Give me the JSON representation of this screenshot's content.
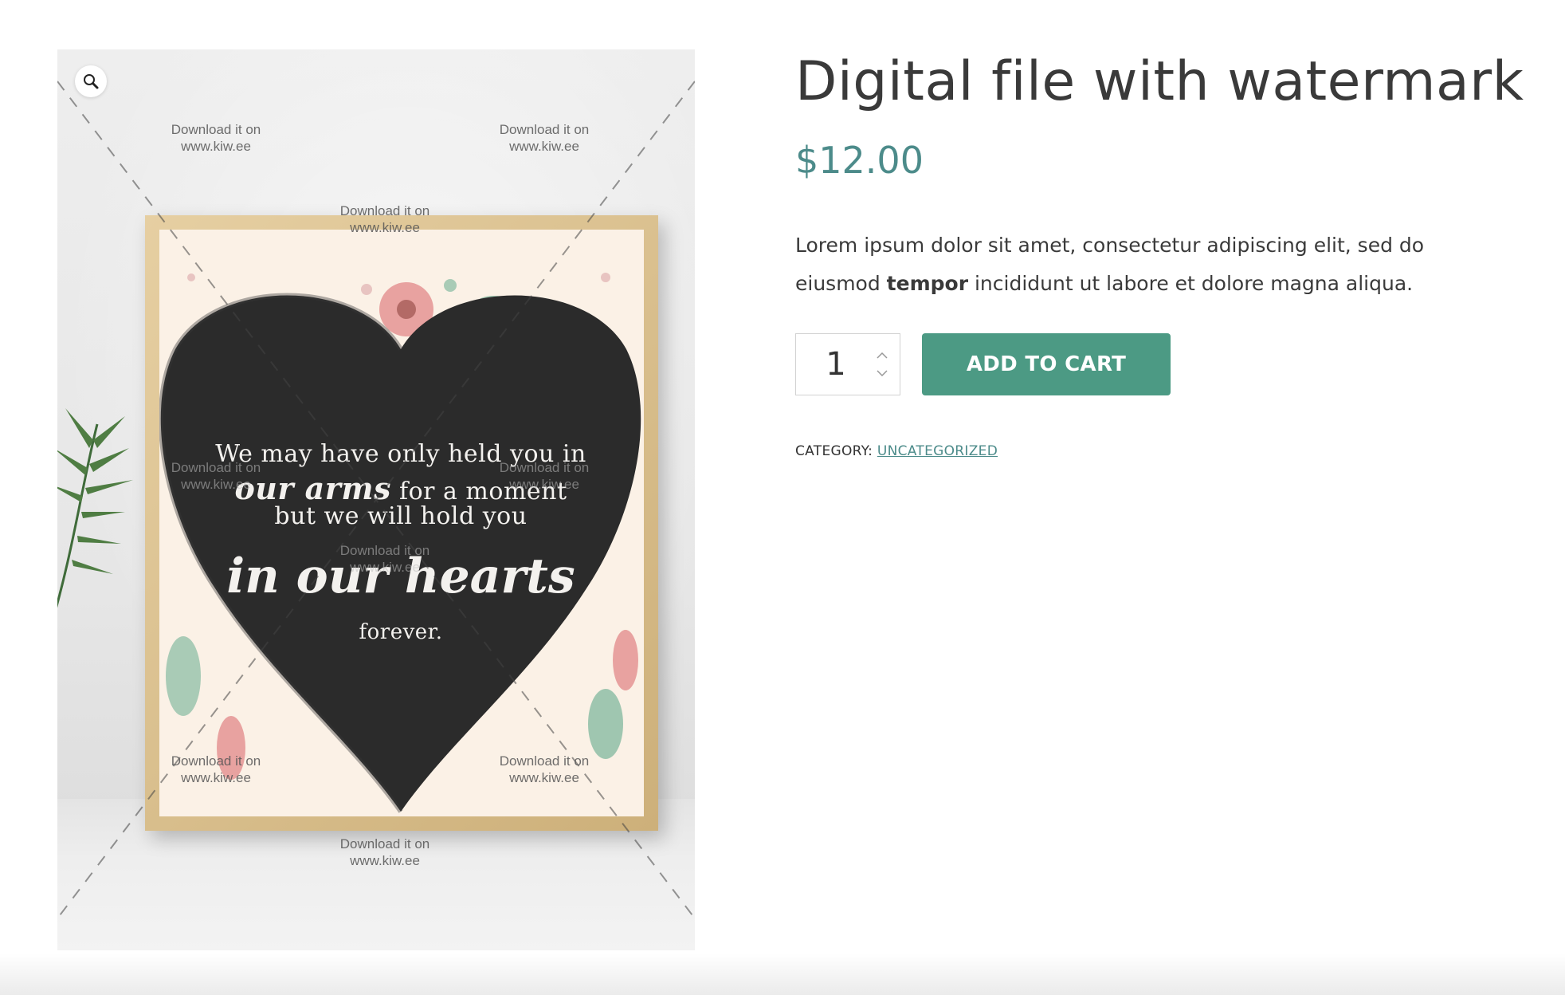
{
  "product": {
    "title": "Digital file with watermark",
    "price": "$12.00",
    "description": {
      "part1": "Lorem ipsum dolor sit amet, consectetur adipiscing elit, sed do eiusmod ",
      "bold": "tempor",
      "part2": " incididunt ut labore et dolore magna aliqua."
    },
    "quantity": "1",
    "add_to_cart_label": "ADD TO CART",
    "category_label": "CATEGORY:",
    "category_value": "UNCATEGORIZED"
  },
  "gallery": {
    "zoom_icon": "magnifier-icon",
    "watermark_line1": "Download it on",
    "watermark_line2": "www.kiw.ee",
    "quote": {
      "line1": "We may have only held you in",
      "line2_script": "our arms",
      "line2_rest": "for a moment",
      "line3": "but we will hold you",
      "line4_script": "in our hearts",
      "line5": "forever."
    }
  },
  "colors": {
    "accent": "#4c9a84",
    "price": "#4c8b8a",
    "text": "#3a3a3a"
  }
}
